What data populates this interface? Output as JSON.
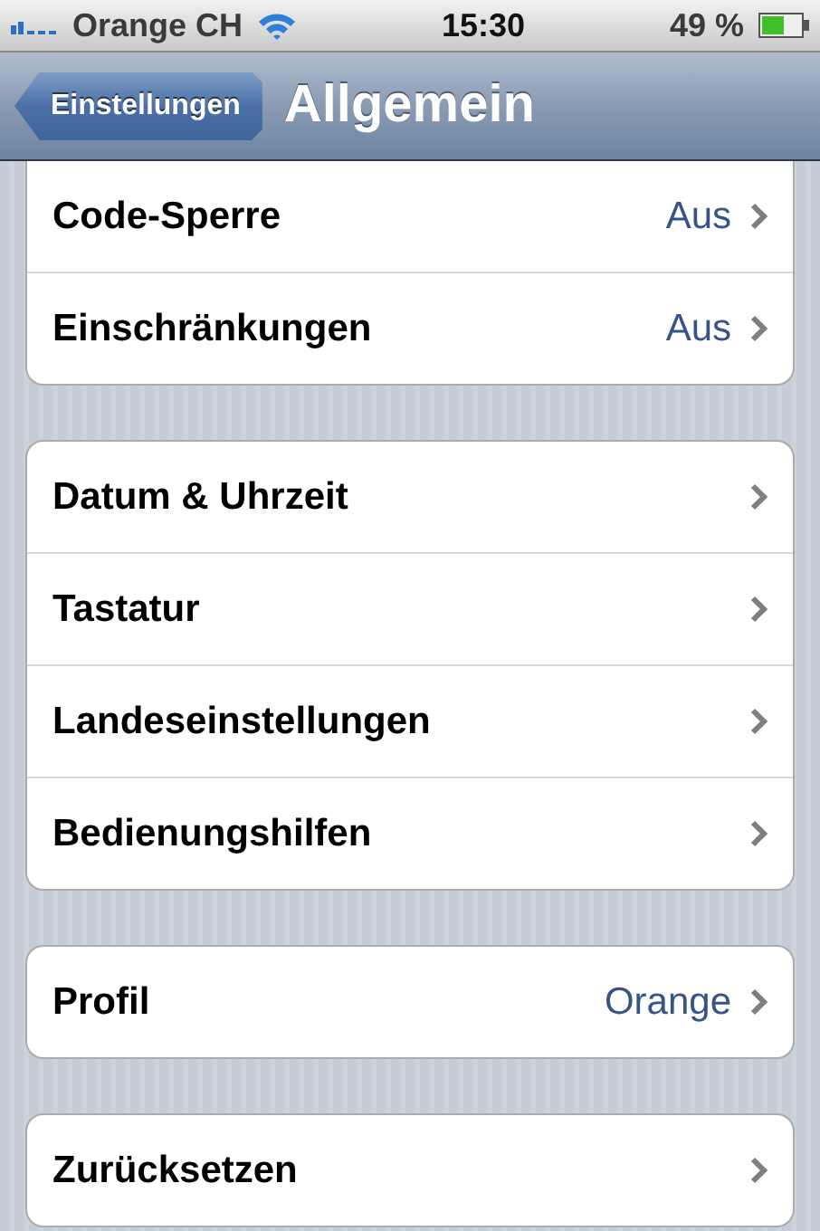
{
  "status_bar": {
    "carrier": "Orange CH",
    "time": "15:30",
    "battery": "49 %"
  },
  "nav_bar": {
    "back": "Einstellungen",
    "title": "Allgemein"
  },
  "groups": [
    {
      "rows": [
        {
          "label": "Code-Sperre",
          "value": "Aus"
        },
        {
          "label": "Einschränkungen",
          "value": "Aus"
        }
      ]
    },
    {
      "rows": [
        {
          "label": "Datum & Uhrzeit"
        },
        {
          "label": "Tastatur"
        },
        {
          "label": "Landeseinstellungen"
        },
        {
          "label": "Bedienungshilfen"
        }
      ]
    },
    {
      "rows": [
        {
          "label": "Profil",
          "value": "Orange"
        }
      ]
    },
    {
      "rows": [
        {
          "label": "Zurücksetzen"
        }
      ]
    }
  ]
}
